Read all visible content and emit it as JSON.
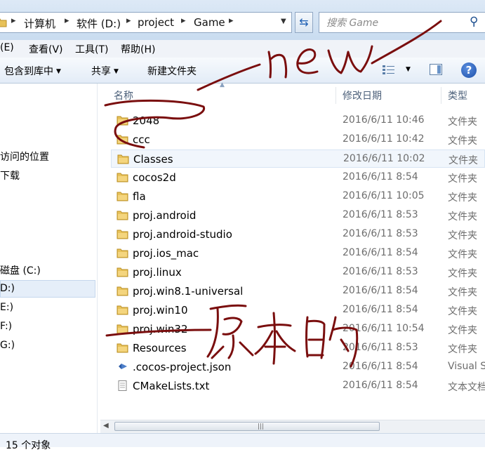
{
  "address": {
    "crumbs": [
      "计算机",
      "软件 (D:)",
      "project",
      "Game"
    ],
    "separator": "▸"
  },
  "search": {
    "placeholder": "搜索 Game"
  },
  "menu": [
    "(E)",
    "查看(V)",
    "工具(T)",
    "帮助(H)"
  ],
  "toolbar": {
    "include": "包含到库中",
    "share": "共享",
    "new_folder": "新建文件夹"
  },
  "nav": [
    "访问的位置",
    "下载",
    "磁盘 (C:)",
    "D:)",
    "E:)",
    "F:)",
    "G:)"
  ],
  "columns": {
    "name": "名称",
    "date": "修改日期",
    "type": "类型"
  },
  "files": [
    {
      "name": "2048",
      "date": "2016/6/11 10:46",
      "type": "文件夹",
      "icon": "folder-icon"
    },
    {
      "name": "ccc",
      "date": "2016/6/11 10:42",
      "type": "文件夹",
      "icon": "folder-icon"
    },
    {
      "name": "Classes",
      "date": "2016/6/11 10:02",
      "type": "文件夹",
      "icon": "folder-icon"
    },
    {
      "name": "cocos2d",
      "date": "2016/6/11 8:54",
      "type": "文件夹",
      "icon": "folder-icon"
    },
    {
      "name": "fla",
      "date": "2016/6/11 10:05",
      "type": "文件夹",
      "icon": "folder-icon"
    },
    {
      "name": "proj.android",
      "date": "2016/6/11 8:53",
      "type": "文件夹",
      "icon": "folder-icon"
    },
    {
      "name": "proj.android-studio",
      "date": "2016/6/11 8:53",
      "type": "文件夹",
      "icon": "folder-icon"
    },
    {
      "name": "proj.ios_mac",
      "date": "2016/6/11 8:54",
      "type": "文件夹",
      "icon": "folder-icon"
    },
    {
      "name": "proj.linux",
      "date": "2016/6/11 8:53",
      "type": "文件夹",
      "icon": "folder-icon"
    },
    {
      "name": "proj.win8.1-universal",
      "date": "2016/6/11 8:54",
      "type": "文件夹",
      "icon": "folder-icon"
    },
    {
      "name": "proj.win10",
      "date": "2016/6/11 8:54",
      "type": "文件夹",
      "icon": "folder-icon"
    },
    {
      "name": "proj.win32",
      "date": "2016/6/11 10:54",
      "type": "文件夹",
      "icon": "folder-icon"
    },
    {
      "name": "Resources",
      "date": "2016/6/11 8:53",
      "type": "文件夹",
      "icon": "folder-icon"
    },
    {
      "name": ".cocos-project.json",
      "date": "2016/6/11 8:54",
      "type": "Visual S",
      "icon": "vs-file-icon"
    },
    {
      "name": "CMakeLists.txt",
      "date": "2016/6/11 8:54",
      "type": "文本文档",
      "icon": "text-file-icon"
    }
  ],
  "status": "15 个对象",
  "annotations": {
    "new_text": "new",
    "original_text": "原本的",
    "ink_color": "#7a0e0e"
  },
  "colors": {
    "selection": "#e5eef9",
    "folder": "#e8c25a",
    "header_text": "#4c607a"
  }
}
